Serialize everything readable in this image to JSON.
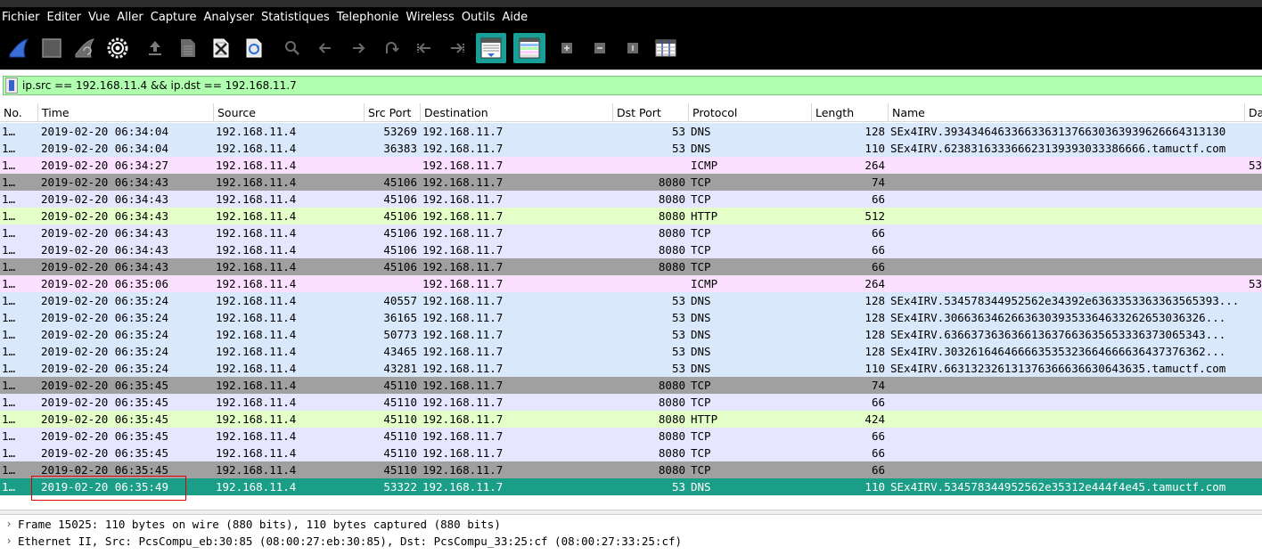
{
  "menubar": {
    "items": [
      "Fichier",
      "Editer",
      "Vue",
      "Aller",
      "Capture",
      "Analyser",
      "Statistiques",
      "Telephonie",
      "Wireless",
      "Outils",
      "Aide"
    ]
  },
  "toolbar": {
    "buttons": [
      {
        "icon": "shark-fin-start-icon"
      },
      {
        "icon": "stop-icon"
      },
      {
        "icon": "restart-icon"
      },
      {
        "icon": "gear-options-icon"
      },
      {
        "icon": "open-file-icon"
      },
      {
        "icon": "save-file-icon"
      },
      {
        "icon": "close-file-icon"
      },
      {
        "icon": "reload-file-icon"
      },
      {
        "icon": "search-icon"
      },
      {
        "icon": "go-back-icon"
      },
      {
        "icon": "go-forward-icon"
      },
      {
        "icon": "go-to-packet-icon"
      },
      {
        "icon": "go-first-icon"
      },
      {
        "icon": "go-last-icon"
      },
      {
        "icon": "autoscroll-icon"
      },
      {
        "icon": "colorize-icon"
      },
      {
        "icon": "zoom-in-icon"
      },
      {
        "icon": "zoom-out-icon"
      },
      {
        "icon": "normal-size-icon"
      },
      {
        "icon": "resize-columns-icon"
      }
    ]
  },
  "filter": {
    "value": "ip.src == 192.168.11.4 && ip.dst == 192.168.11.7"
  },
  "columns": [
    "No.",
    "Time",
    "Source",
    "Src Port",
    "Destination",
    "Dst Port",
    "Protocol",
    "Length",
    "Name",
    "Da"
  ],
  "colors": {
    "dns": "#dae8fc",
    "icmp": "#fce0ff",
    "tcp_gray": "#a0a0a0",
    "tcp": "#e7e6ff",
    "http": "#e4ffc7",
    "selected": "#1b9e87",
    "highlight_box": "#e00000"
  },
  "packets": [
    {
      "no": "1…",
      "time": "2019-02-20 06:34:04",
      "source": "192.168.11.4",
      "srcport": "53269",
      "destination": "192.168.11.7",
      "dstport": "53",
      "protocol": "DNS",
      "length": "128",
      "name": "SEx4IRV.393434646336633631376630363939626664313130",
      "da": "",
      "color": "dns"
    },
    {
      "no": "1…",
      "time": "2019-02-20 06:34:04",
      "source": "192.168.11.4",
      "srcport": "36383",
      "destination": "192.168.11.7",
      "dstport": "53",
      "protocol": "DNS",
      "length": "110",
      "name": "SEx4IRV.623831633366623139393033386666.tamuctf.com",
      "da": "",
      "color": "dns"
    },
    {
      "no": "1…",
      "time": "2019-02-20 06:34:27",
      "source": "192.168.11.4",
      "srcport": "",
      "destination": "192.168.11.7",
      "dstport": "",
      "protocol": "ICMP",
      "length": "264",
      "name": "",
      "da": "53",
      "color": "icmp"
    },
    {
      "no": "1…",
      "time": "2019-02-20 06:34:43",
      "source": "192.168.11.4",
      "srcport": "45106",
      "destination": "192.168.11.7",
      "dstport": "8080",
      "protocol": "TCP",
      "length": "74",
      "name": "",
      "da": "",
      "color": "tcp_gray"
    },
    {
      "no": "1…",
      "time": "2019-02-20 06:34:43",
      "source": "192.168.11.4",
      "srcport": "45106",
      "destination": "192.168.11.7",
      "dstport": "8080",
      "protocol": "TCP",
      "length": "66",
      "name": "",
      "da": "",
      "color": "tcp"
    },
    {
      "no": "1…",
      "time": "2019-02-20 06:34:43",
      "source": "192.168.11.4",
      "srcport": "45106",
      "destination": "192.168.11.7",
      "dstport": "8080",
      "protocol": "HTTP",
      "length": "512",
      "name": "",
      "da": "",
      "color": "http"
    },
    {
      "no": "1…",
      "time": "2019-02-20 06:34:43",
      "source": "192.168.11.4",
      "srcport": "45106",
      "destination": "192.168.11.7",
      "dstport": "8080",
      "protocol": "TCP",
      "length": "66",
      "name": "",
      "da": "",
      "color": "tcp"
    },
    {
      "no": "1…",
      "time": "2019-02-20 06:34:43",
      "source": "192.168.11.4",
      "srcport": "45106",
      "destination": "192.168.11.7",
      "dstport": "8080",
      "protocol": "TCP",
      "length": "66",
      "name": "",
      "da": "",
      "color": "tcp"
    },
    {
      "no": "1…",
      "time": "2019-02-20 06:34:43",
      "source": "192.168.11.4",
      "srcport": "45106",
      "destination": "192.168.11.7",
      "dstport": "8080",
      "protocol": "TCP",
      "length": "66",
      "name": "",
      "da": "",
      "color": "tcp_gray"
    },
    {
      "no": "1…",
      "time": "2019-02-20 06:35:06",
      "source": "192.168.11.4",
      "srcport": "",
      "destination": "192.168.11.7",
      "dstport": "",
      "protocol": "ICMP",
      "length": "264",
      "name": "",
      "da": "53",
      "color": "icmp"
    },
    {
      "no": "1…",
      "time": "2019-02-20 06:35:24",
      "source": "192.168.11.4",
      "srcport": "40557",
      "destination": "192.168.11.7",
      "dstport": "53",
      "protocol": "DNS",
      "length": "128",
      "name": "SEx4IRV.534578344952562e34392e6363353363363565393...",
      "da": "",
      "color": "dns"
    },
    {
      "no": "1…",
      "time": "2019-02-20 06:35:24",
      "source": "192.168.11.4",
      "srcport": "36165",
      "destination": "192.168.11.7",
      "dstport": "53",
      "protocol": "DNS",
      "length": "128",
      "name": "SEx4IRV.306636346266363039353364633262653036326...",
      "da": "",
      "color": "dns"
    },
    {
      "no": "1…",
      "time": "2019-02-20 06:35:24",
      "source": "192.168.11.4",
      "srcport": "50773",
      "destination": "192.168.11.7",
      "dstport": "53",
      "protocol": "DNS",
      "length": "128",
      "name": "SEx4IRV.636637363636613637663635653336373065343...",
      "da": "",
      "color": "dns"
    },
    {
      "no": "1…",
      "time": "2019-02-20 06:35:24",
      "source": "192.168.11.4",
      "srcport": "43465",
      "destination": "192.168.11.7",
      "dstport": "53",
      "protocol": "DNS",
      "length": "128",
      "name": "SEx4IRV.303261646466663535323664666636437376362...",
      "da": "",
      "color": "dns"
    },
    {
      "no": "1…",
      "time": "2019-02-20 06:35:24",
      "source": "192.168.11.4",
      "srcport": "43281",
      "destination": "192.168.11.7",
      "dstport": "53",
      "protocol": "DNS",
      "length": "110",
      "name": "SEx4IRV.663132326131376366636630643635.tamuctf.com",
      "da": "",
      "color": "dns"
    },
    {
      "no": "1…",
      "time": "2019-02-20 06:35:45",
      "source": "192.168.11.4",
      "srcport": "45110",
      "destination": "192.168.11.7",
      "dstport": "8080",
      "protocol": "TCP",
      "length": "74",
      "name": "",
      "da": "",
      "color": "tcp_gray"
    },
    {
      "no": "1…",
      "time": "2019-02-20 06:35:45",
      "source": "192.168.11.4",
      "srcport": "45110",
      "destination": "192.168.11.7",
      "dstport": "8080",
      "protocol": "TCP",
      "length": "66",
      "name": "",
      "da": "",
      "color": "tcp"
    },
    {
      "no": "1…",
      "time": "2019-02-20 06:35:45",
      "source": "192.168.11.4",
      "srcport": "45110",
      "destination": "192.168.11.7",
      "dstport": "8080",
      "protocol": "HTTP",
      "length": "424",
      "name": "",
      "da": "",
      "color": "http"
    },
    {
      "no": "1…",
      "time": "2019-02-20 06:35:45",
      "source": "192.168.11.4",
      "srcport": "45110",
      "destination": "192.168.11.7",
      "dstport": "8080",
      "protocol": "TCP",
      "length": "66",
      "name": "",
      "da": "",
      "color": "tcp"
    },
    {
      "no": "1…",
      "time": "2019-02-20 06:35:45",
      "source": "192.168.11.4",
      "srcport": "45110",
      "destination": "192.168.11.7",
      "dstport": "8080",
      "protocol": "TCP",
      "length": "66",
      "name": "",
      "da": "",
      "color": "tcp"
    },
    {
      "no": "1…",
      "time": "2019-02-20 06:35:45",
      "source": "192.168.11.4",
      "srcport": "45110",
      "destination": "192.168.11.7",
      "dstport": "8080",
      "protocol": "TCP",
      "length": "66",
      "name": "",
      "da": "",
      "color": "tcp_gray"
    },
    {
      "no": "1…",
      "time": "2019-02-20 06:35:49",
      "source": "192.168.11.4",
      "srcport": "53322",
      "destination": "192.168.11.7",
      "dstport": "53",
      "protocol": "DNS",
      "length": "110",
      "name": "SEx4IRV.534578344952562e35312e444f4e45.tamuctf.com",
      "da": "",
      "color": "selected",
      "selected": true
    }
  ],
  "details": [
    "Frame 15025: 110 bytes on wire (880 bits), 110 bytes captured (880 bits)",
    "Ethernet II, Src: PcsCompu_eb:30:85 (08:00:27:eb:30:85), Dst: PcsCompu_33:25:cf (08:00:27:33:25:cf)"
  ]
}
